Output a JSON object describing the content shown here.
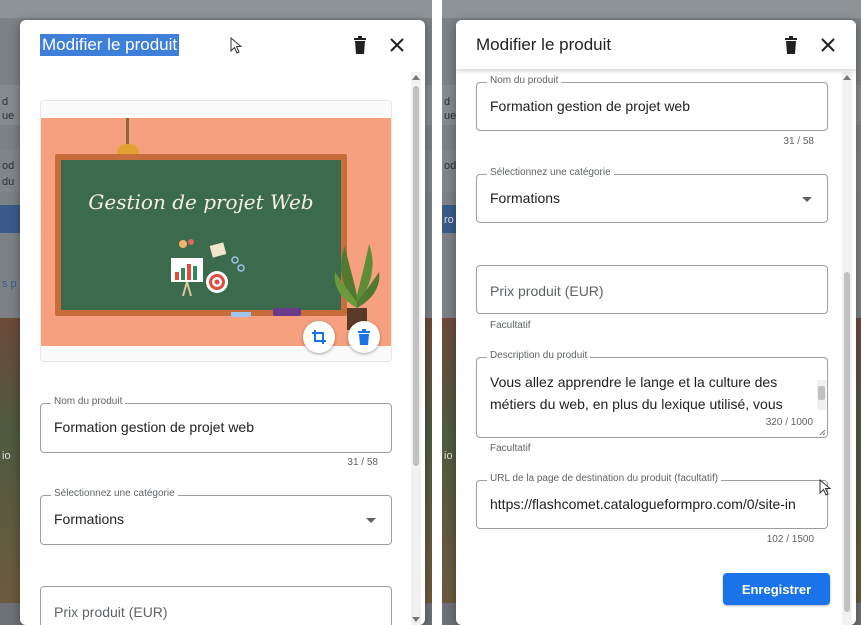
{
  "background_app": {
    "snippets": [
      "d",
      "ue",
      "od",
      "du",
      "ro",
      "s p",
      "io"
    ]
  },
  "left_panel": {
    "dialog": {
      "title": "Modifier le produit",
      "image": {
        "board_text": "Gestion de projet Web"
      },
      "product_name": {
        "label": "Nom du produit",
        "value": "Formation gestion de projet web",
        "counter": "31 / 58"
      },
      "category": {
        "label": "Sélectionnez une catégorie",
        "value": "Formations"
      },
      "price": {
        "placeholder": "Prix produit (EUR)"
      }
    }
  },
  "right_panel": {
    "dialog": {
      "title": "Modifier le produit",
      "product_name": {
        "label": "Nom du produit",
        "value": "Formation gestion de projet web",
        "counter": "31 / 58"
      },
      "category": {
        "label": "Sélectionnez une catégorie",
        "value": "Formations"
      },
      "price": {
        "placeholder": "Prix produit (EUR)",
        "helper": "Facultatif"
      },
      "description": {
        "label": "Description du produit",
        "value": "Vous allez apprendre le lange et la culture des métiers du web, en plus du lexique utilisé, vous",
        "counter": "320 / 1000",
        "helper": "Facultatif"
      },
      "url": {
        "label": "URL de la page de destination du produit (facultatif)",
        "value": "https://flashcomet.catalogueformpro.com/0/site-in",
        "counter": "102 / 1500"
      },
      "save_label": "Enregistrer"
    }
  },
  "colors": {
    "accent": "#1a73e8",
    "selection": "#3d7fd9",
    "board_green": "#3b6a4c",
    "image_bg": "#f6a07f"
  },
  "icons": [
    "trash-icon",
    "close-icon",
    "crop-icon",
    "cursor-icon",
    "dropdown-arrow-icon"
  ]
}
